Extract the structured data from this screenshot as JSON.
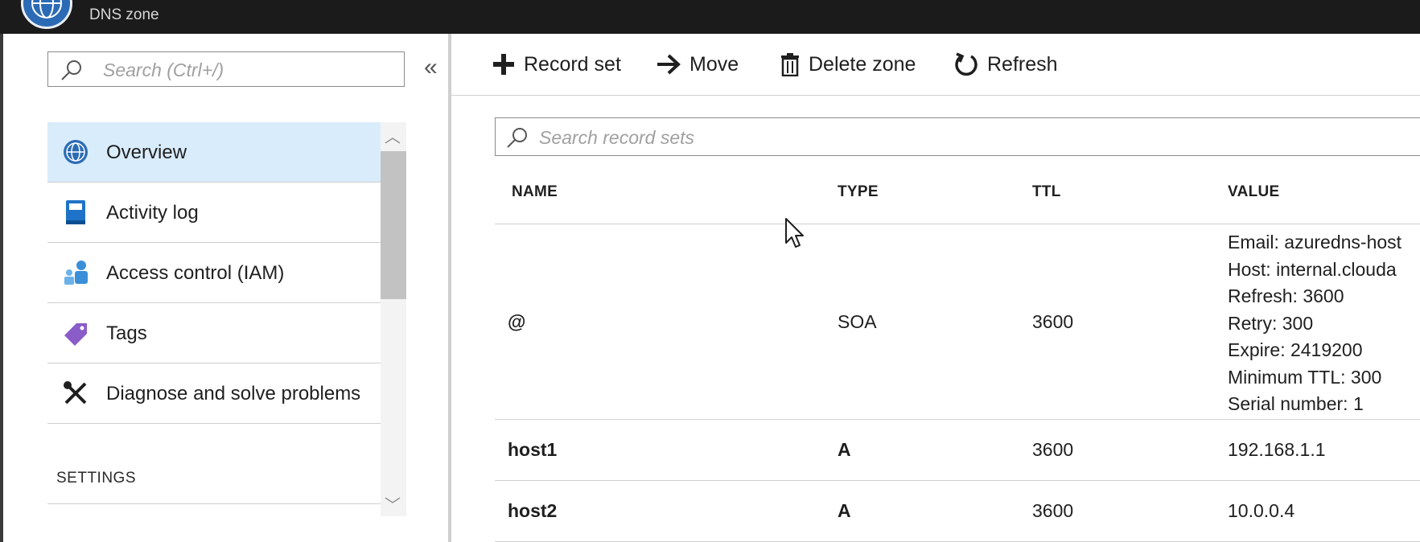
{
  "header": {
    "subtitle": "DNS zone",
    "logo_icon": "dns-globe-icon"
  },
  "sidebar": {
    "search_placeholder": "Search (Ctrl+/)",
    "collapse_label": "«",
    "items": [
      {
        "label": "Overview",
        "icon": "dns-globe-icon",
        "active": true
      },
      {
        "label": "Activity log",
        "icon": "book-icon"
      },
      {
        "label": "Access control (IAM)",
        "icon": "users-icon"
      },
      {
        "label": "Tags",
        "icon": "tag-icon"
      },
      {
        "label": "Diagnose and solve problems",
        "icon": "tools-icon"
      }
    ],
    "section_heading": "SETTINGS"
  },
  "toolbar": {
    "record_set": "Record set",
    "move": "Move",
    "delete_zone": "Delete zone",
    "refresh": "Refresh"
  },
  "records": {
    "search_placeholder": "Search record sets",
    "columns": [
      "NAME",
      "TYPE",
      "TTL",
      "VALUE"
    ],
    "rows": [
      {
        "name": "@",
        "type": "SOA",
        "ttl": "3600",
        "value": [
          "Email: azuredns-host",
          "Host: internal.clouda",
          "Refresh: 3600",
          "Retry: 300",
          "Expire: 2419200",
          "Minimum TTL: 300",
          "Serial number: 1"
        ]
      },
      {
        "name": "host1",
        "type": "A",
        "ttl": "3600",
        "value": [
          "192.168.1.1"
        ]
      },
      {
        "name": "host2",
        "type": "A",
        "ttl": "3600",
        "value": [
          "10.0.0.4"
        ]
      }
    ]
  },
  "colors": {
    "header_bg": "#1b1b1c",
    "active_item_bg": "#d9ecfb",
    "accent_blue": "#2b6bb5",
    "tag_purple": "#8a5cc7"
  }
}
